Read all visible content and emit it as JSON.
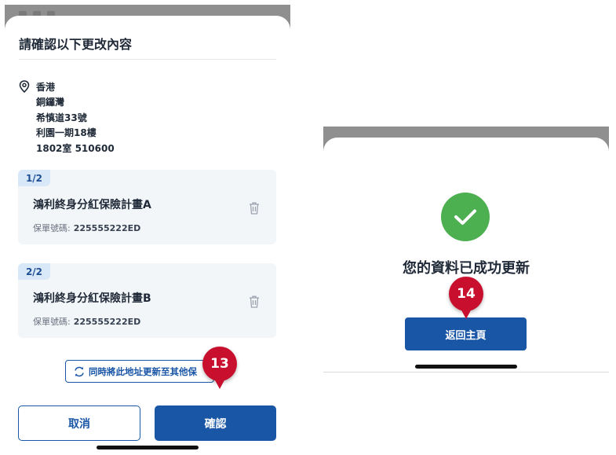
{
  "confirm_screen": {
    "title": "請確認以下更改內容",
    "address_lines": [
      "香港",
      "銅鑼灣",
      "希慎道33號",
      "利園一期18樓",
      "1802室 510600"
    ],
    "policies": [
      {
        "index": "1/2",
        "name": "鴻利終身分紅保險計畫A",
        "number_label": "保單號碼:",
        "number": "225555222ED"
      },
      {
        "index": "2/2",
        "name": "鴻利終身分紅保險計畫B",
        "number_label": "保單號碼:",
        "number": "225555222ED"
      }
    ],
    "sync_label": "同時將此地址更新至其他保",
    "cancel_label": "取消",
    "confirm_label": "確認",
    "step_marker": "13"
  },
  "success_screen": {
    "message": "您的資料已成功更新",
    "home_label": "返回主頁",
    "step_marker": "14"
  },
  "icons": {
    "location": "location-pin-icon",
    "delete": "trash-icon",
    "sync": "sync-icon",
    "success": "check-circle-icon"
  },
  "colors": {
    "primary_blue": "#1a56a6",
    "card_bg": "#f3f6f9",
    "badge_bg": "#d9e8f8",
    "step_red": "#c8102e",
    "success_green": "#4caf50"
  }
}
